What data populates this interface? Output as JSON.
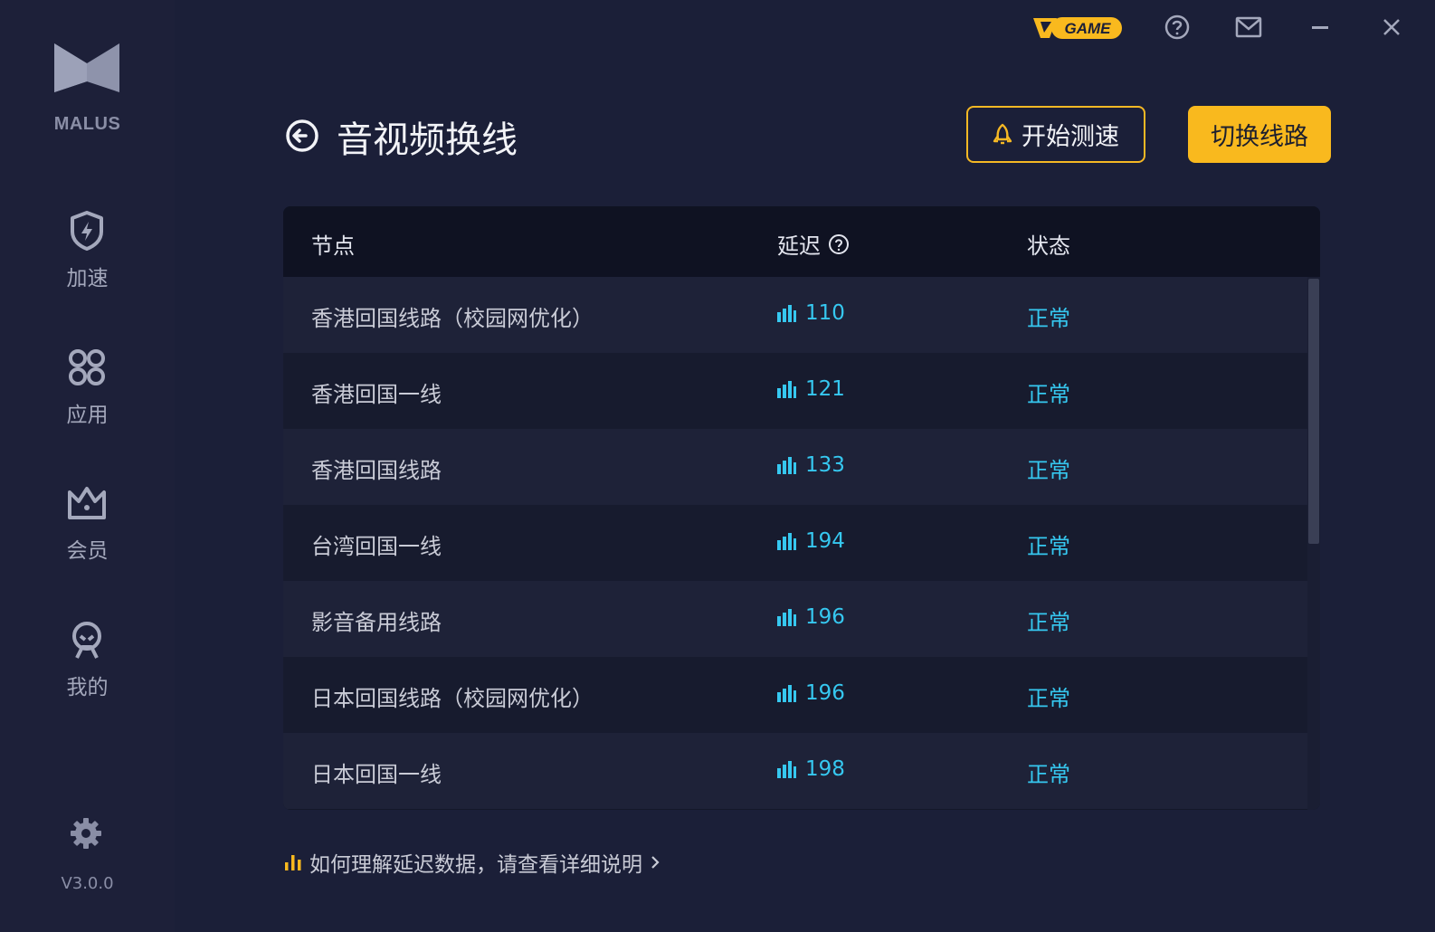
{
  "app": {
    "brand": "MALUS",
    "version": "V3.0.0",
    "game_badge": "GAME",
    "accent_color": "#f9b91e",
    "latency_color": "#36c8f0"
  },
  "sidebar": {
    "items": [
      {
        "label": "加速",
        "icon": "shield-bolt-icon"
      },
      {
        "label": "应用",
        "icon": "apps-icon"
      },
      {
        "label": "会员",
        "icon": "crown-icon"
      },
      {
        "label": "我的",
        "icon": "profile-icon"
      }
    ]
  },
  "header": {
    "title": "音视频换线",
    "test_button": "开始测速",
    "switch_button": "切换线路"
  },
  "table": {
    "columns": [
      "节点",
      "延迟",
      "状态"
    ],
    "rows": [
      {
        "name": "香港回国线路（校园网优化）",
        "latency": "110",
        "status": "正常"
      },
      {
        "name": "香港回国一线",
        "latency": "121",
        "status": "正常"
      },
      {
        "name": "香港回国线路",
        "latency": "133",
        "status": "正常"
      },
      {
        "name": "台湾回国一线",
        "latency": "194",
        "status": "正常"
      },
      {
        "name": "影音备用线路",
        "latency": "196",
        "status": "正常"
      },
      {
        "name": "日本回国线路（校园网优化）",
        "latency": "196",
        "status": "正常"
      },
      {
        "name": "日本回国一线",
        "latency": "198",
        "status": "正常"
      }
    ]
  },
  "footer": {
    "help_link": "如何理解延迟数据，请查看详细说明"
  }
}
